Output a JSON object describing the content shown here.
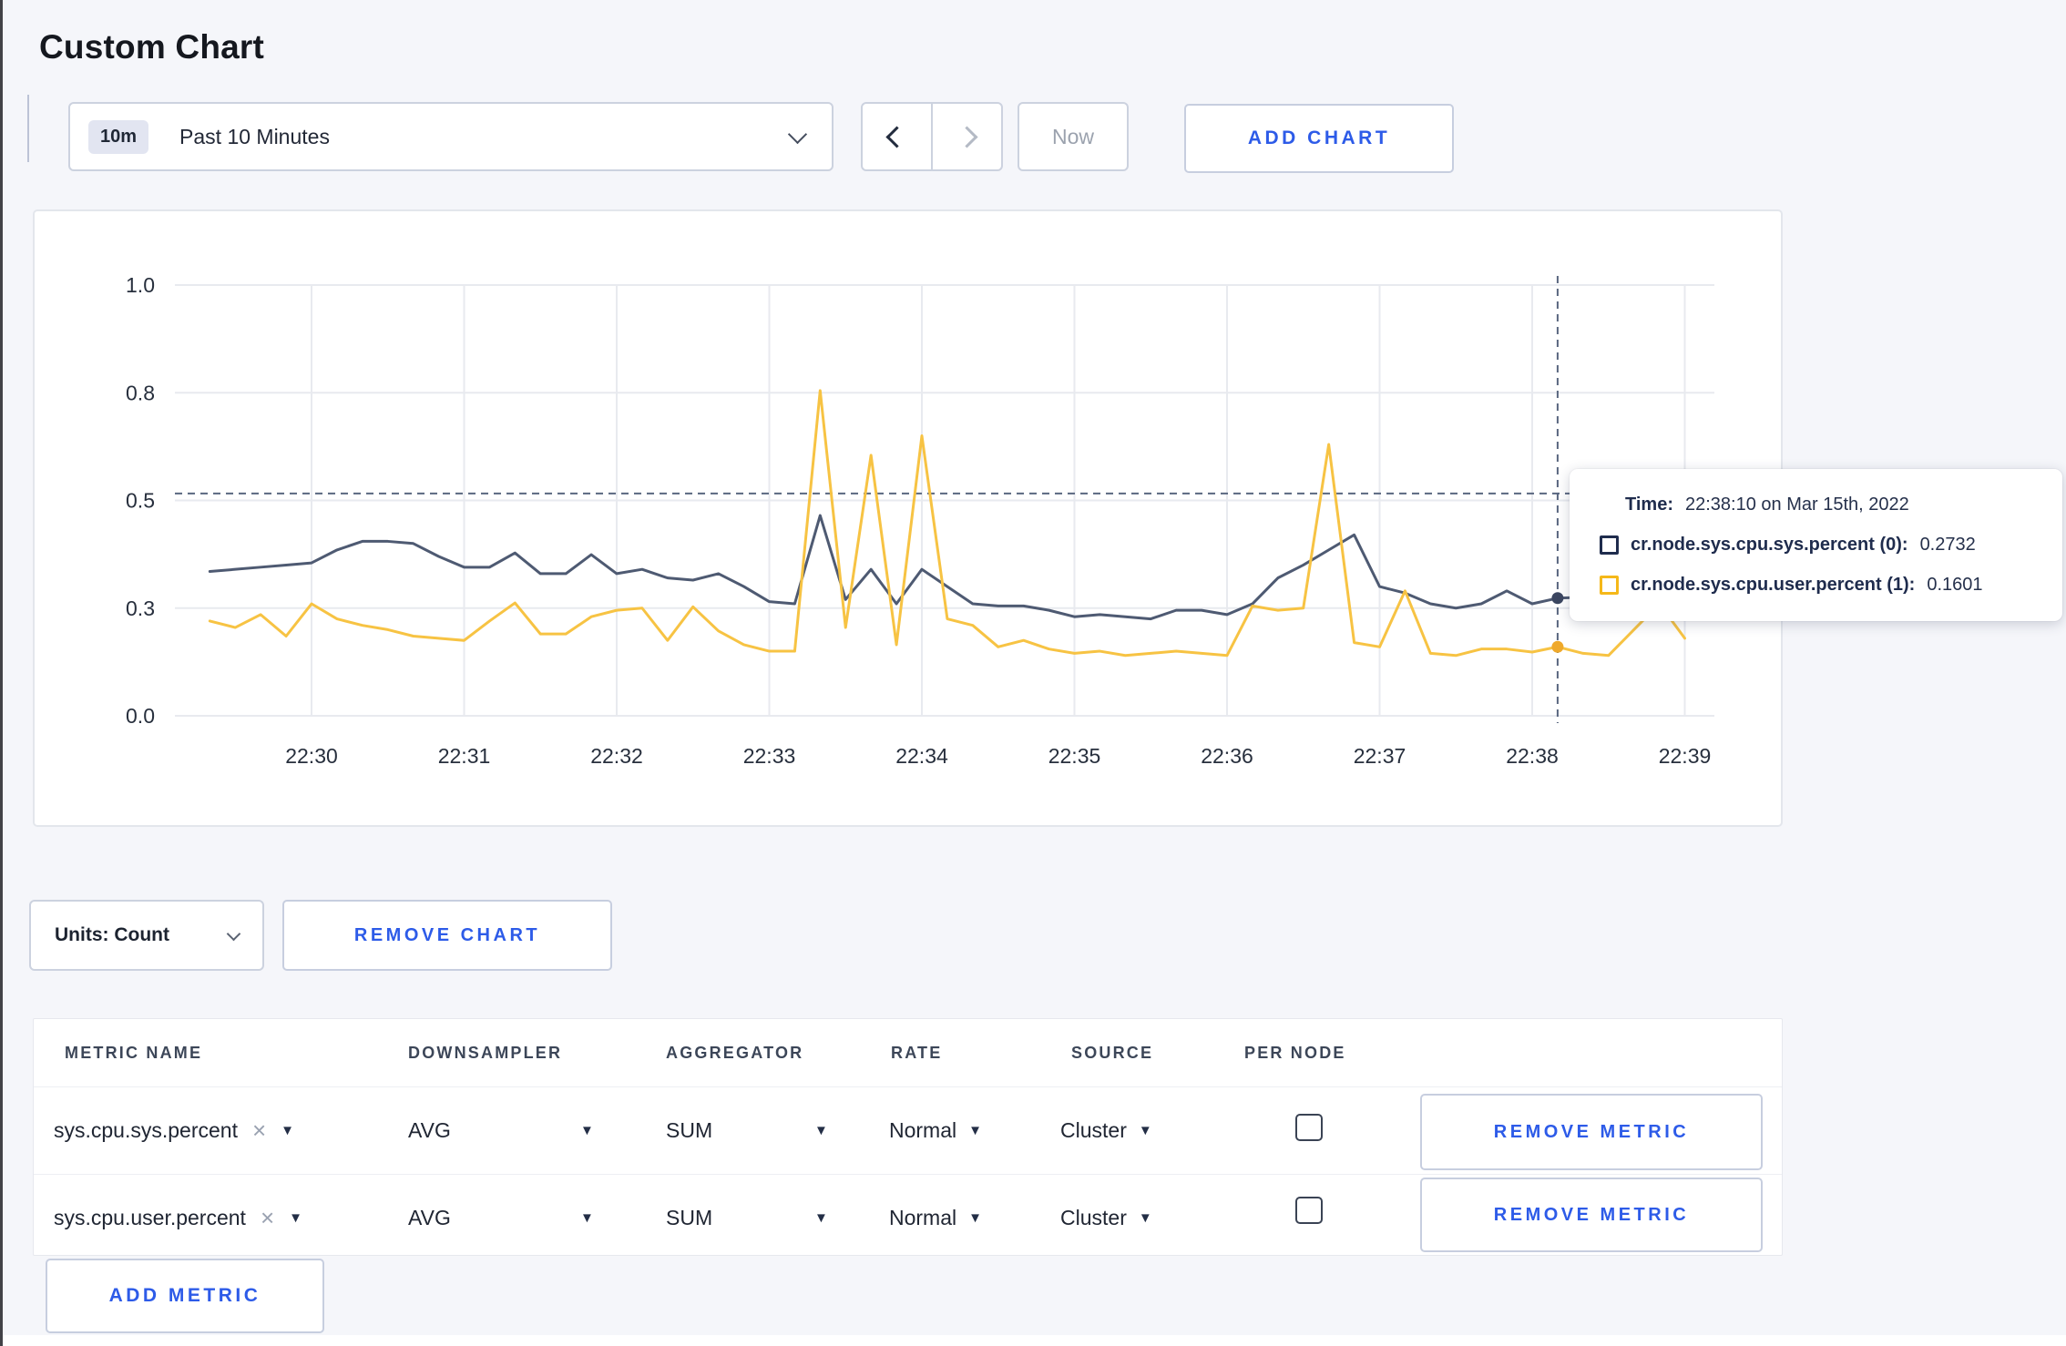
{
  "page": {
    "title": "Custom Chart"
  },
  "toolbar": {
    "time_window_badge": "10m",
    "time_window_label": "Past 10 Minutes",
    "now_label": "Now",
    "add_chart_label": "ADD CHART"
  },
  "glyphs": {
    "caret_down": "▼",
    "close": "×"
  },
  "chart_data": {
    "type": "line",
    "title": "",
    "xlabel": "",
    "ylabel": "",
    "ylim": [
      0,
      1
    ],
    "grid": true,
    "legend_position": "none",
    "y_ticks": [
      0,
      0.25,
      0.5,
      0.75,
      1.0
    ],
    "y_tick_labels": [
      "0.0",
      "0.3",
      "0.5",
      "0.8",
      "1.0"
    ],
    "x_ticks": [
      "22:30",
      "22:31",
      "22:32",
      "22:33",
      "22:34",
      "22:35",
      "22:36",
      "22:37",
      "22:38",
      "22:39"
    ],
    "x": [
      "22:29:20",
      "22:29:30",
      "22:29:40",
      "22:29:50",
      "22:30:00",
      "22:30:10",
      "22:30:20",
      "22:30:30",
      "22:30:40",
      "22:30:50",
      "22:31:00",
      "22:31:10",
      "22:31:20",
      "22:31:30",
      "22:31:40",
      "22:31:50",
      "22:32:00",
      "22:32:10",
      "22:32:20",
      "22:32:30",
      "22:32:40",
      "22:32:50",
      "22:33:00",
      "22:33:10",
      "22:33:20",
      "22:33:30",
      "22:33:40",
      "22:33:50",
      "22:34:00",
      "22:34:10",
      "22:34:20",
      "22:34:30",
      "22:34:40",
      "22:34:50",
      "22:35:00",
      "22:35:10",
      "22:35:20",
      "22:35:30",
      "22:35:40",
      "22:35:50",
      "22:36:00",
      "22:36:10",
      "22:36:20",
      "22:36:30",
      "22:36:40",
      "22:36:50",
      "22:37:00",
      "22:37:10",
      "22:37:20",
      "22:37:30",
      "22:37:40",
      "22:37:50",
      "22:38:00",
      "22:38:10",
      "22:38:20",
      "22:38:30",
      "22:38:40",
      "22:38:50",
      "22:39:00"
    ],
    "series": [
      {
        "name": "cr.node.sys.cpu.sys.percent",
        "color": "#4e5a72",
        "dot_color": "#3b4660",
        "values": [
          0.335,
          0.34,
          0.345,
          0.35,
          0.355,
          0.385,
          0.405,
          0.405,
          0.4,
          0.37,
          0.345,
          0.345,
          0.378,
          0.33,
          0.33,
          0.374,
          0.33,
          0.34,
          0.32,
          0.315,
          0.33,
          0.3,
          0.265,
          0.26,
          0.465,
          0.27,
          0.34,
          0.26,
          0.34,
          0.3,
          0.26,
          0.255,
          0.255,
          0.245,
          0.23,
          0.235,
          0.23,
          0.225,
          0.245,
          0.245,
          0.235,
          0.26,
          0.32,
          0.35,
          0.385,
          0.42,
          0.3,
          0.285,
          0.26,
          0.25,
          0.26,
          0.29,
          0.26,
          0.2732,
          0.275,
          0.28,
          0.285,
          0.29,
          0.295
        ]
      },
      {
        "name": "cr.node.sys.cpu.user.percent",
        "color": "#f7c343",
        "dot_color": "#efa92b",
        "values": [
          0.22,
          0.205,
          0.235,
          0.185,
          0.26,
          0.225,
          0.21,
          0.2,
          0.185,
          0.18,
          0.175,
          0.22,
          0.262,
          0.19,
          0.19,
          0.23,
          0.245,
          0.25,
          0.175,
          0.253,
          0.197,
          0.165,
          0.15,
          0.15,
          0.755,
          0.205,
          0.605,
          0.165,
          0.65,
          0.225,
          0.21,
          0.16,
          0.175,
          0.155,
          0.145,
          0.15,
          0.14,
          0.145,
          0.15,
          0.145,
          0.14,
          0.255,
          0.245,
          0.25,
          0.63,
          0.17,
          0.16,
          0.29,
          0.145,
          0.14,
          0.155,
          0.155,
          0.148,
          0.1601,
          0.145,
          0.14,
          0.2,
          0.26,
          0.18
        ]
      }
    ],
    "crosshair": {
      "x_time": "22:38:10",
      "y_value": 0.516
    }
  },
  "chart_colors": {
    "gridline": "#e8eaef",
    "tick_text": "#272f3d",
    "crosshair": "#5a6780"
  },
  "tooltip": {
    "time_label": "Time:",
    "time_value": "22:38:10 on Mar 15th, 2022",
    "rows": [
      {
        "name": "cr.node.sys.cpu.sys.percent (0):",
        "value": "0.2732",
        "swatch_color": "#1f2c4d"
      },
      {
        "name": "cr.node.sys.cpu.user.percent (1):",
        "value": "0.1601",
        "swatch_color": "#f5b819"
      }
    ]
  },
  "chart_footer": {
    "units_label": "Units: Count",
    "remove_chart_label": "REMOVE CHART"
  },
  "metrics_table": {
    "headers": [
      "METRIC NAME",
      "DOWNSAMPLER",
      "AGGREGATOR",
      "RATE",
      "SOURCE",
      "PER NODE"
    ],
    "rows": [
      {
        "metric": "sys.cpu.sys.percent",
        "downsampler": "AVG",
        "aggregator": "SUM",
        "rate": "Normal",
        "source": "Cluster",
        "per_node_checked": false,
        "remove_label": "REMOVE METRIC"
      },
      {
        "metric": "sys.cpu.user.percent",
        "downsampler": "AVG",
        "aggregator": "SUM",
        "rate": "Normal",
        "source": "Cluster",
        "per_node_checked": false,
        "remove_label": "REMOVE METRIC"
      }
    ],
    "add_metric_label": "ADD METRIC"
  }
}
